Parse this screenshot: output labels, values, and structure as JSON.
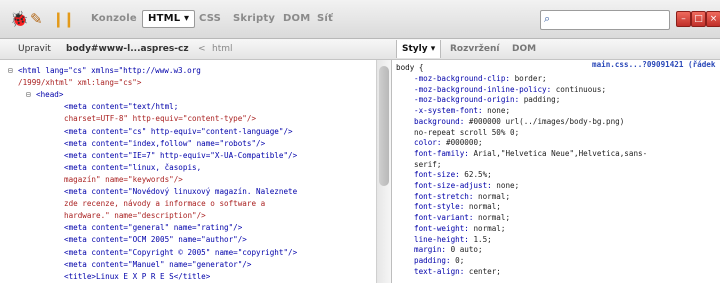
{
  "toolbar": {
    "tabs": [
      {
        "label": "Konzole",
        "active": false
      },
      {
        "label": "HTML ▾",
        "active": true
      },
      {
        "label": "CSS",
        "active": false
      },
      {
        "label": "Skripty",
        "active": false
      },
      {
        "label": "DOM",
        "active": false
      },
      {
        "label": "Síť",
        "active": false
      }
    ],
    "search_placeholder": "",
    "icons": [
      "firebug-icon",
      "inspect-icon",
      "pause-icon",
      "search-icon"
    ],
    "window_buttons": [
      "–",
      "□",
      "×"
    ]
  },
  "breadcrumb": {
    "edit_label": "Upravit",
    "path_current": "body#www-l...aspres-cz",
    "path_sep": "<",
    "path_parent": "html"
  },
  "side_tabs": [
    {
      "label": "Styly ▾",
      "active": true
    },
    {
      "label": "Rozvržení",
      "active": false
    },
    {
      "label": "DOM",
      "active": false
    }
  ],
  "html_lines": [
    {
      "indent": 0,
      "toggle": "⊟",
      "text": "<html lang=\"cs\" xmlns=\"http://www.w3.org",
      "kind": "tag"
    },
    {
      "indent": 0,
      "toggle": "",
      "text": "/1999/xhtml\" xml:lang=\"cs\">",
      "kind": "attr"
    },
    {
      "indent": 1,
      "toggle": "⊟",
      "text": "<head>",
      "kind": "tag"
    },
    {
      "indent": 2,
      "toggle": "",
      "text": "<meta content=\"text/html;",
      "kind": "tag"
    },
    {
      "indent": 2,
      "toggle": "",
      "text": "charset=UTF-8\" http-equiv=\"content-type\"/>",
      "kind": "attr"
    },
    {
      "indent": 2,
      "toggle": "",
      "text": "<meta content=\"cs\" http-equiv=\"content-language\"/>",
      "kind": "tag"
    },
    {
      "indent": 2,
      "toggle": "",
      "text": "<meta content=\"index,follow\" name=\"robots\"/>",
      "kind": "tag"
    },
    {
      "indent": 2,
      "toggle": "",
      "text": "<meta content=\"IE=7\" http-equiv=\"X-UA-Compatible\"/>",
      "kind": "tag"
    },
    {
      "indent": 2,
      "toggle": "",
      "text": "<meta content=\"linux, časopis,",
      "kind": "tag"
    },
    {
      "indent": 2,
      "toggle": "",
      "text": "magazín\" name=\"keywords\"/>",
      "kind": "attr"
    },
    {
      "indent": 2,
      "toggle": "",
      "text": "<meta content=\"Novédový linuxový magazín. Naleznete",
      "kind": "tag"
    },
    {
      "indent": 2,
      "toggle": "",
      "text": "zde recenze, návody a informace o software a",
      "kind": "attr"
    },
    {
      "indent": 2,
      "toggle": "",
      "text": "hardware.\" name=\"description\"/>",
      "kind": "attr"
    },
    {
      "indent": 2,
      "toggle": "",
      "text": "<meta content=\"general\" name=\"rating\"/>",
      "kind": "tag"
    },
    {
      "indent": 2,
      "toggle": "",
      "text": "<meta content=\"OCM 2005\" name=\"author\"/>",
      "kind": "tag"
    },
    {
      "indent": 2,
      "toggle": "",
      "text": "<meta content=\"Copyright © 2005\" name=\"copyright\"/>",
      "kind": "tag"
    },
    {
      "indent": 2,
      "toggle": "",
      "text": "<meta content=\"Manuel\" name=\"generator\"/>",
      "kind": "tag"
    },
    {
      "indent": 2,
      "toggle": "",
      "text": "<title>Linux E X P R E S</title>",
      "kind": "tag"
    }
  ],
  "css": {
    "selector": "body {",
    "source": "main.css...?09091421 (řádek 1)",
    "rules": [
      {
        "prop": "-moz-background-clip:",
        "value": "border;"
      },
      {
        "prop": "-moz-background-inline-policy:",
        "value": "continuous;"
      },
      {
        "prop": "-moz-background-origin:",
        "value": "padding;"
      },
      {
        "prop": "-x-system-font:",
        "value": "none;"
      },
      {
        "prop": "background:",
        "value": "#000000 url(../images/body-bg.png)"
      },
      {
        "prop": "",
        "value": "no-repeat scroll 50% 0;"
      },
      {
        "prop": "color:",
        "value": "#000000;"
      },
      {
        "prop": "font-family:",
        "value": "Arial,\"Helvetica Neue\",Helvetica,sans-"
      },
      {
        "prop": "",
        "value": "serif;"
      },
      {
        "prop": "font-size:",
        "value": "62.5%;"
      },
      {
        "prop": "font-size-adjust:",
        "value": "none;"
      },
      {
        "prop": "font-stretch:",
        "value": "normal;"
      },
      {
        "prop": "font-style:",
        "value": "normal;"
      },
      {
        "prop": "font-variant:",
        "value": "normal;"
      },
      {
        "prop": "font-weight:",
        "value": "normal;"
      },
      {
        "prop": "line-height:",
        "value": "1.5;"
      },
      {
        "prop": "margin:",
        "value": "0 auto;"
      },
      {
        "prop": "padding:",
        "value": "0;"
      },
      {
        "prop": "text-align:",
        "value": "center;"
      }
    ]
  }
}
